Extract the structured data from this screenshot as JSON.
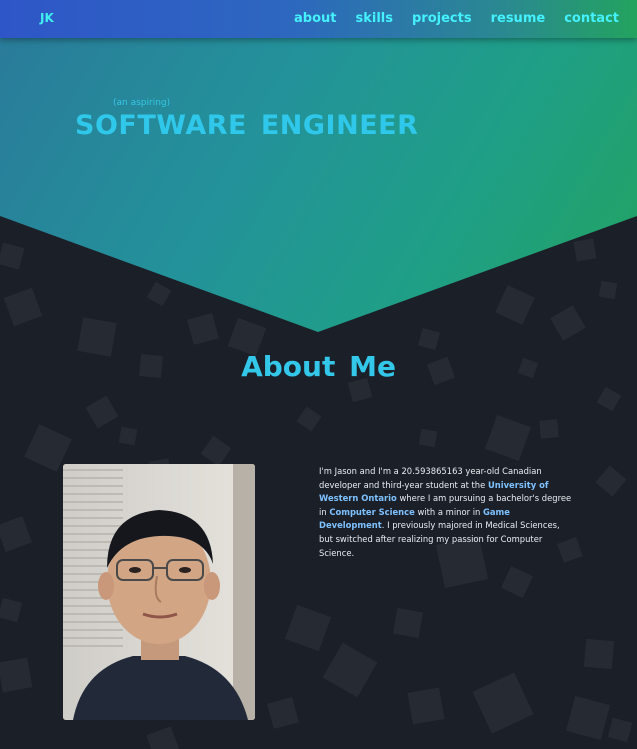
{
  "nav": {
    "logo": "JK",
    "links": [
      "about",
      "skills",
      "projects",
      "resume",
      "contact"
    ]
  },
  "hero": {
    "pre_title": "(an aspiring)",
    "title": "SOFTWARE  ENGINEER"
  },
  "about": {
    "heading": "About  Me",
    "bio": {
      "part1": "I'm Jason and I'm a 20.593865163 year-old Canadian developer and third-year student at the ",
      "link1": "University of Western Ontario",
      "part2": " where I am pursuing a bachelor's degree in ",
      "link2": "Computer Science",
      "part3": " with a minor in ",
      "link3": "Game Development",
      "part4": ". I previously majored in Medical Sciences, but switched after realizing my passion for Computer Science."
    }
  },
  "colors": {
    "accent": "#33c7ea",
    "background": "#1b1f27",
    "link": "#7ec1ff"
  }
}
